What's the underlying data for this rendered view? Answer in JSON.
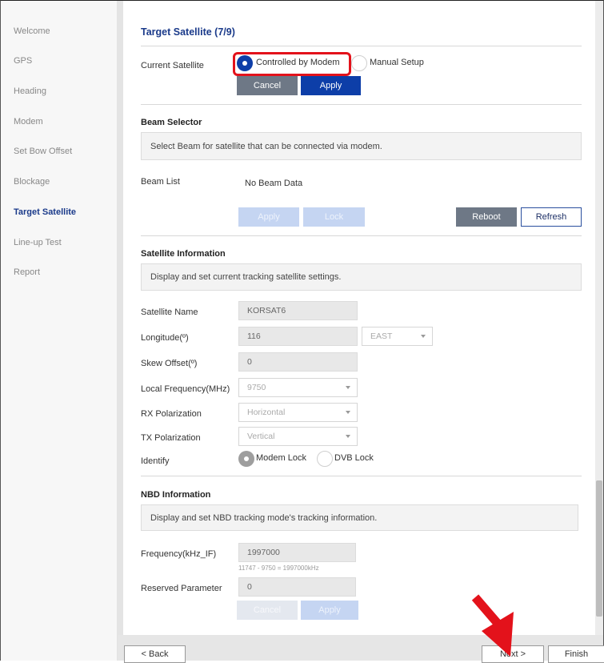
{
  "sidebar": {
    "items": [
      {
        "label": "Welcome"
      },
      {
        "label": "GPS"
      },
      {
        "label": "Heading"
      },
      {
        "label": "Modem"
      },
      {
        "label": "Set Bow Offset"
      },
      {
        "label": "Blockage"
      },
      {
        "label": "Target Satellite"
      },
      {
        "label": "Line-up Test"
      },
      {
        "label": "Report"
      }
    ],
    "active": "Target Satellite"
  },
  "page": {
    "title": "Target Satellite (7/9)"
  },
  "current_satellite": {
    "label": "Current Satellite",
    "option_modem": "Controlled by Modem",
    "option_manual": "Manual Setup",
    "selected": "Controlled by Modem",
    "cancel": "Cancel",
    "apply": "Apply"
  },
  "beam_selector": {
    "heading": "Beam Selector",
    "description": "Select Beam for satellite that can be connected via modem.",
    "list_label": "Beam List",
    "list_value": "No Beam Data",
    "apply": "Apply",
    "lock": "Lock",
    "reboot": "Reboot",
    "refresh": "Refresh"
  },
  "satellite_info": {
    "heading": "Satellite Information",
    "description": "Display and set current tracking satellite settings.",
    "name_label": "Satellite Name",
    "name_value": "KORSAT6",
    "longitude_label": "Longitude(º)",
    "longitude_value": "116",
    "longitude_dir": "EAST",
    "skew_label": "Skew Offset(º)",
    "skew_value": "0",
    "lo_label": "Local Frequency(MHz)",
    "lo_value": "9750",
    "rx_label": "RX Polarization",
    "rx_value": "Horizontal",
    "tx_label": "TX Polarization",
    "tx_value": "Vertical",
    "identify_label": "Identify",
    "identify_modem": "Modem Lock",
    "identify_dvb": "DVB Lock",
    "identify_selected": "Modem Lock"
  },
  "nbd_info": {
    "heading": "NBD Information",
    "description": "Display and set NBD tracking mode's tracking information.",
    "freq_label": "Frequency(kHz_IF)",
    "freq_value": "1997000",
    "freq_hint": "11747 - 9750 = 1997000kHz",
    "reserved_label": "Reserved Parameter",
    "reserved_value": "0",
    "cancel": "Cancel",
    "apply": "Apply"
  },
  "footer": {
    "back": "< Back",
    "next": "Next >",
    "finish": "Finish"
  },
  "colors": {
    "accent": "#0d3ea8",
    "title": "#1a3a8a",
    "highlight": "#e3121b",
    "arrow": "#e3121b"
  }
}
